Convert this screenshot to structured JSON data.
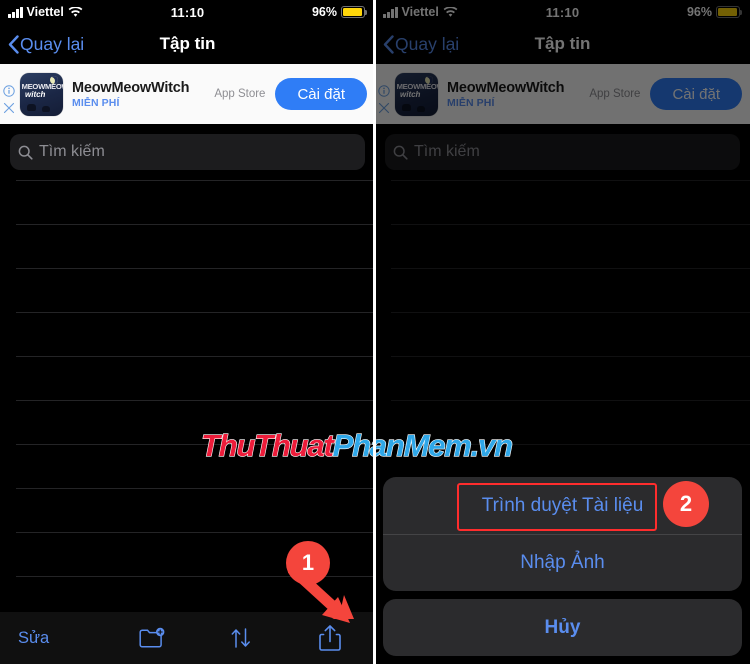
{
  "meta": {
    "device": "iPhone",
    "app": "Files (Tập tin)",
    "accent_blue": "#5a8dee",
    "annotation_red": "#ff2d2d",
    "badge_red": "#f4453c"
  },
  "status_bar": {
    "carrier": "Viettel",
    "time": "11:10",
    "battery_percent": "96%",
    "signal_icon": "signal-bars-icon",
    "wifi_icon": "wifi-icon",
    "battery_icon": "battery-icon"
  },
  "nav_bar": {
    "back_label": "Quay lại",
    "back_icon": "chevron-left-icon",
    "title": "Tập tin"
  },
  "ad_banner": {
    "app_name": "MeowMeowWitch",
    "price_label": "MIỄN PHÍ",
    "store_label": "App Store",
    "install_label": "Cài đặt",
    "info_icon": "info-circle-icon",
    "close_icon": "close-x-icon",
    "icon_title_top": "MEOWMEOW",
    "icon_title_bottom": "witch"
  },
  "search": {
    "placeholder": "Tìm kiếm",
    "icon": "search-icon"
  },
  "file_list": {
    "rows": [
      "",
      "",
      "",
      "",
      "",
      "",
      "",
      "",
      "",
      ""
    ],
    "empty": true
  },
  "toolbar": {
    "edit_label": "Sửa",
    "new_folder_icon": "folder-plus-icon",
    "sort_icon": "sort-arrows-icon",
    "share_icon": "share-upload-icon"
  },
  "action_sheet": {
    "items": [
      {
        "label": "Trình duyệt Tài liệu",
        "name": "document-browser"
      },
      {
        "label": "Nhập Ảnh",
        "name": "import-photo"
      }
    ],
    "cancel_label": "Hủy"
  },
  "annotations": {
    "step_one": "1",
    "step_two": "2"
  },
  "watermark": {
    "part_red": "ThuThuat",
    "part_blue": "PhanMem.vn"
  }
}
